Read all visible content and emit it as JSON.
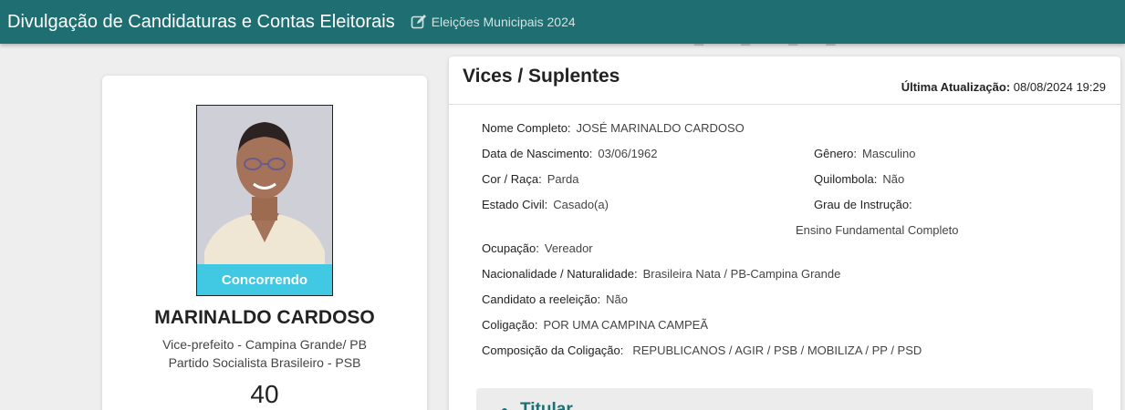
{
  "header": {
    "title": "Divulgação de Candidaturas e Contas Eleitorais",
    "subtitle": "Eleições Municipais 2024",
    "edit_icon": "edit-icon"
  },
  "candidate": {
    "status_badge": "Concorrendo",
    "name": "MARINALDO CARDOSO",
    "role": "Vice-prefeito - Campina Grande/ PB",
    "party": "Partido Socialista Brasileiro - PSB",
    "number": "40"
  },
  "details": {
    "section_title": "Vices / Suplentes",
    "last_update_label": "Última Atualização:",
    "last_update_value": "08/08/2024 19:29",
    "fields": {
      "full_name": {
        "label": "Nome Completo:",
        "value": "JOSÉ MARINALDO CARDOSO"
      },
      "birth_date": {
        "label": "Data de Nascimento:",
        "value": "03/06/1962"
      },
      "gender": {
        "label": "Gênero:",
        "value": "Masculino"
      },
      "race": {
        "label": "Cor / Raça:",
        "value": "Parda"
      },
      "quilombola": {
        "label": "Quilombola:",
        "value": "Não"
      },
      "marital": {
        "label": "Estado Civil:",
        "value": "Casado(a)"
      },
      "education": {
        "label": "Grau de Instrução:",
        "value": "Ensino Fundamental Completo"
      },
      "occupation": {
        "label": "Ocupação:",
        "value": "Vereador"
      },
      "nationality": {
        "label": "Nacionalidade / Naturalidade:",
        "value": "Brasileira Nata / PB-Campina Grande"
      },
      "reelection": {
        "label": "Candidato a reeleição:",
        "value": "Não"
      },
      "coalition": {
        "label": "Coligação:",
        "value": "POR UMA CAMPINA CAMPEÃ"
      },
      "coalition_parties": {
        "label": "Composição da Coligação:",
        "value": "REPUBLICANOS / AGIR / PSB / MOBILIZA / PP / PSD"
      }
    },
    "titular_label": "Titular"
  }
}
